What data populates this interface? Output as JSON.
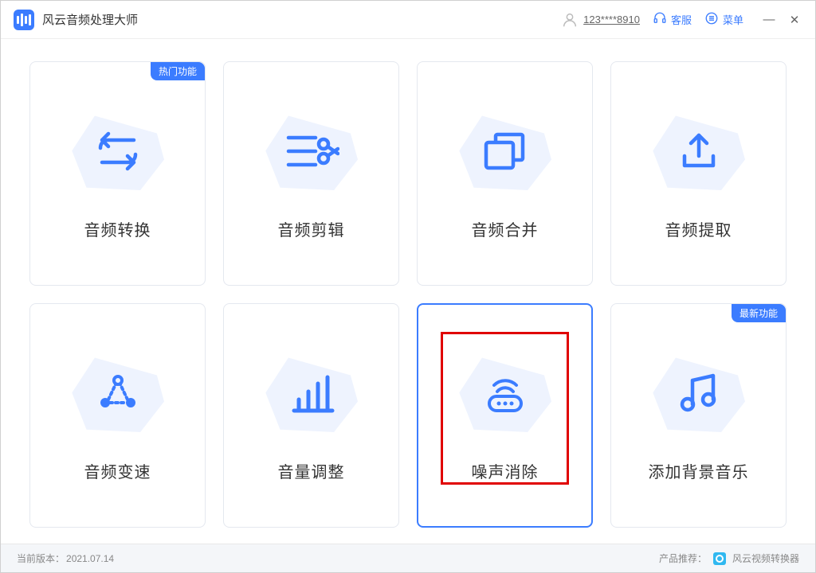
{
  "app": {
    "title": "风云音频处理大师"
  },
  "header": {
    "username": "123****8910",
    "support_label": "客服",
    "menu_label": "菜单"
  },
  "badges": {
    "hot": "热门功能",
    "new": "最新功能"
  },
  "cards": [
    {
      "label": "音频转换",
      "icon": "convert",
      "badge": "hot"
    },
    {
      "label": "音频剪辑",
      "icon": "cut"
    },
    {
      "label": "音频合并",
      "icon": "merge"
    },
    {
      "label": "音频提取",
      "icon": "extract"
    },
    {
      "label": "音频变速",
      "icon": "speed"
    },
    {
      "label": "音量调整",
      "icon": "volume"
    },
    {
      "label": "噪声消除",
      "icon": "noise",
      "selected": true,
      "highlighted": true
    },
    {
      "label": "添加背景音乐",
      "icon": "music",
      "badge": "new"
    }
  ],
  "footer": {
    "version_label": "当前版本：",
    "version_value": "2021.07.14",
    "recommend_label": "产品推荐：",
    "recommend_product": "风云视频转换器"
  },
  "colors": {
    "primary": "#3b7cff"
  }
}
